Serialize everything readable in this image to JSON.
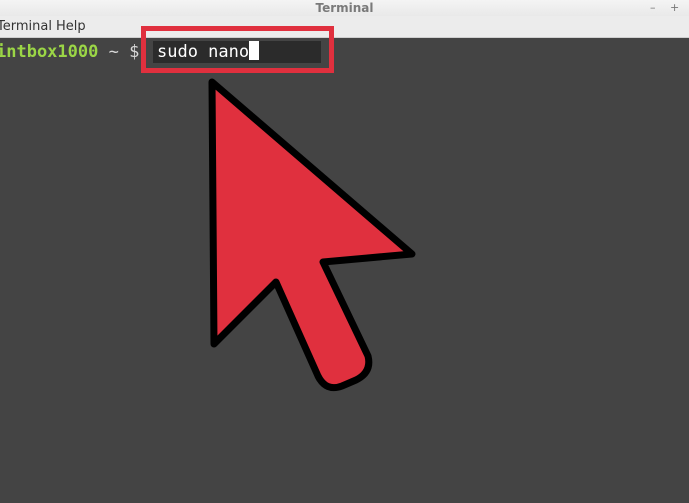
{
  "window": {
    "title": "Terminal",
    "controls": {
      "minimize": "–",
      "maximize": "+"
    }
  },
  "menu": {
    "items": [
      "Terminal",
      "Help"
    ]
  },
  "terminal": {
    "prompt_user": "intbox1000",
    "prompt_sep": " ~ $",
    "command": "sudo nano"
  },
  "annotation": {
    "highlight_color": "#e0303e",
    "arrow_color": "#e0303e",
    "arrow_icon": "pointer-arrow-icon"
  }
}
